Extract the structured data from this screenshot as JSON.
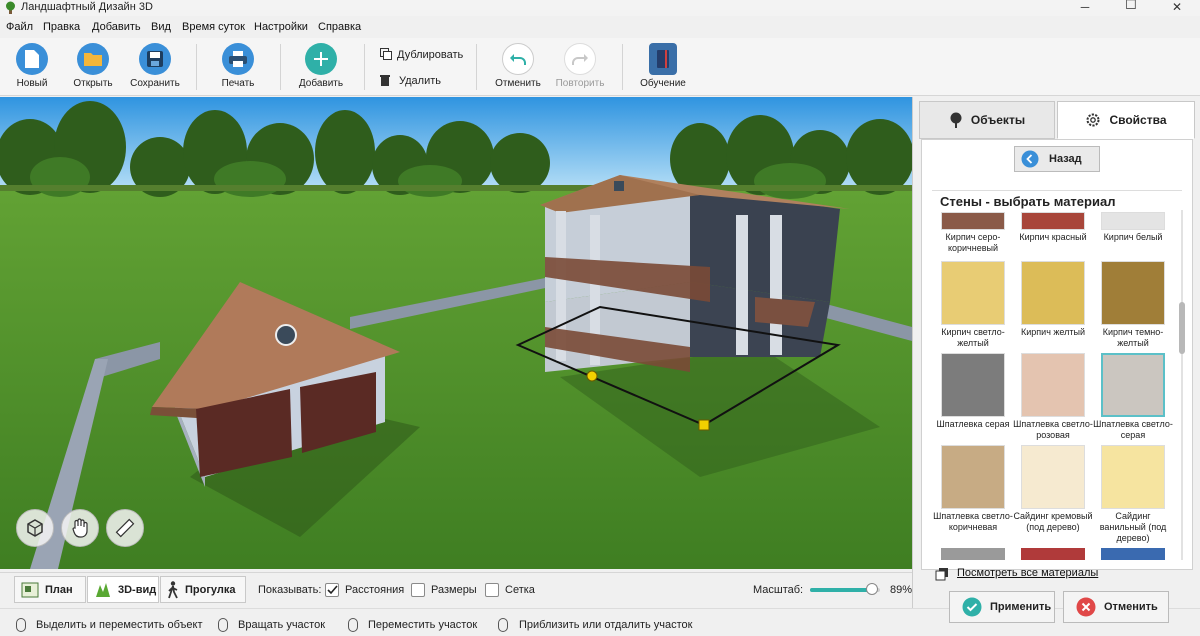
{
  "window": {
    "title": "Ландшафтный Дизайн 3D",
    "minimize": "─",
    "maximize": "☐",
    "close": "✕"
  },
  "menu": [
    "Файл",
    "Правка",
    "Добавить",
    "Вид",
    "Время суток",
    "Настройки",
    "Справка"
  ],
  "toolbar": {
    "new": "Новый",
    "open": "Открыть",
    "save": "Сохранить",
    "print": "Печать",
    "add": "Добавить",
    "duplicate": "Дублировать",
    "delete": "Удалить",
    "undo": "Отменить",
    "redo": "Повторить",
    "learn": "Обучение"
  },
  "viewbar": {
    "plan": "План",
    "view3d": "3D-вид",
    "walk": "Прогулка",
    "show_label": "Показывать:",
    "distances": "Расстояния",
    "distances_checked": true,
    "sizes": "Размеры",
    "sizes_checked": false,
    "grid": "Сетка",
    "grid_checked": false,
    "scale_label": "Масштаб:",
    "scale_value": "89%",
    "scale_fraction": 0.89
  },
  "status": [
    "Выделить и переместить объект",
    "Вращать участок",
    "Переместить участок",
    "Приблизить или отдалить участок"
  ],
  "panel": {
    "tab_objects": "Объекты",
    "tab_properties": "Свойства",
    "back": "Назад",
    "section_title": "Стены - выбрать материал",
    "materials": [
      {
        "name": "Кирпич серо-коричневый",
        "color": "#8a5a48"
      },
      {
        "name": "Кирпич красный",
        "color": "#a8463a"
      },
      {
        "name": "Кирпич белый",
        "color": "#e4e4e4"
      },
      {
        "name": "Кирпич светло-желтый",
        "color": "#e8cc74"
      },
      {
        "name": "Кирпич желтый",
        "color": "#dcbc58"
      },
      {
        "name": "Кирпич темно-желтый",
        "color": "#a07e38"
      },
      {
        "name": "Шпатлевка серая",
        "color": "#7c7c7c"
      },
      {
        "name": "Шпатлевка светло-розовая",
        "color": "#e4c4b0"
      },
      {
        "name": "Шпатлевка светло-серая",
        "color": "#cbc6c0"
      },
      {
        "name": "Шпатлевка светло-коричневая",
        "color": "#c7ab84"
      },
      {
        "name": "Сайдинг кремовый (под дерево)",
        "color": "#f6ead0"
      },
      {
        "name": "Сайдинг ванильный (под дерево)",
        "color": "#f6e4a0"
      }
    ],
    "see_all": "Посмотреть все материалы",
    "apply": "Применить",
    "cancel": "Отменить"
  },
  "colors": {
    "accent": "#2fb0a8",
    "grass": "#4f8d2a",
    "sky": "#3fa4e6"
  }
}
